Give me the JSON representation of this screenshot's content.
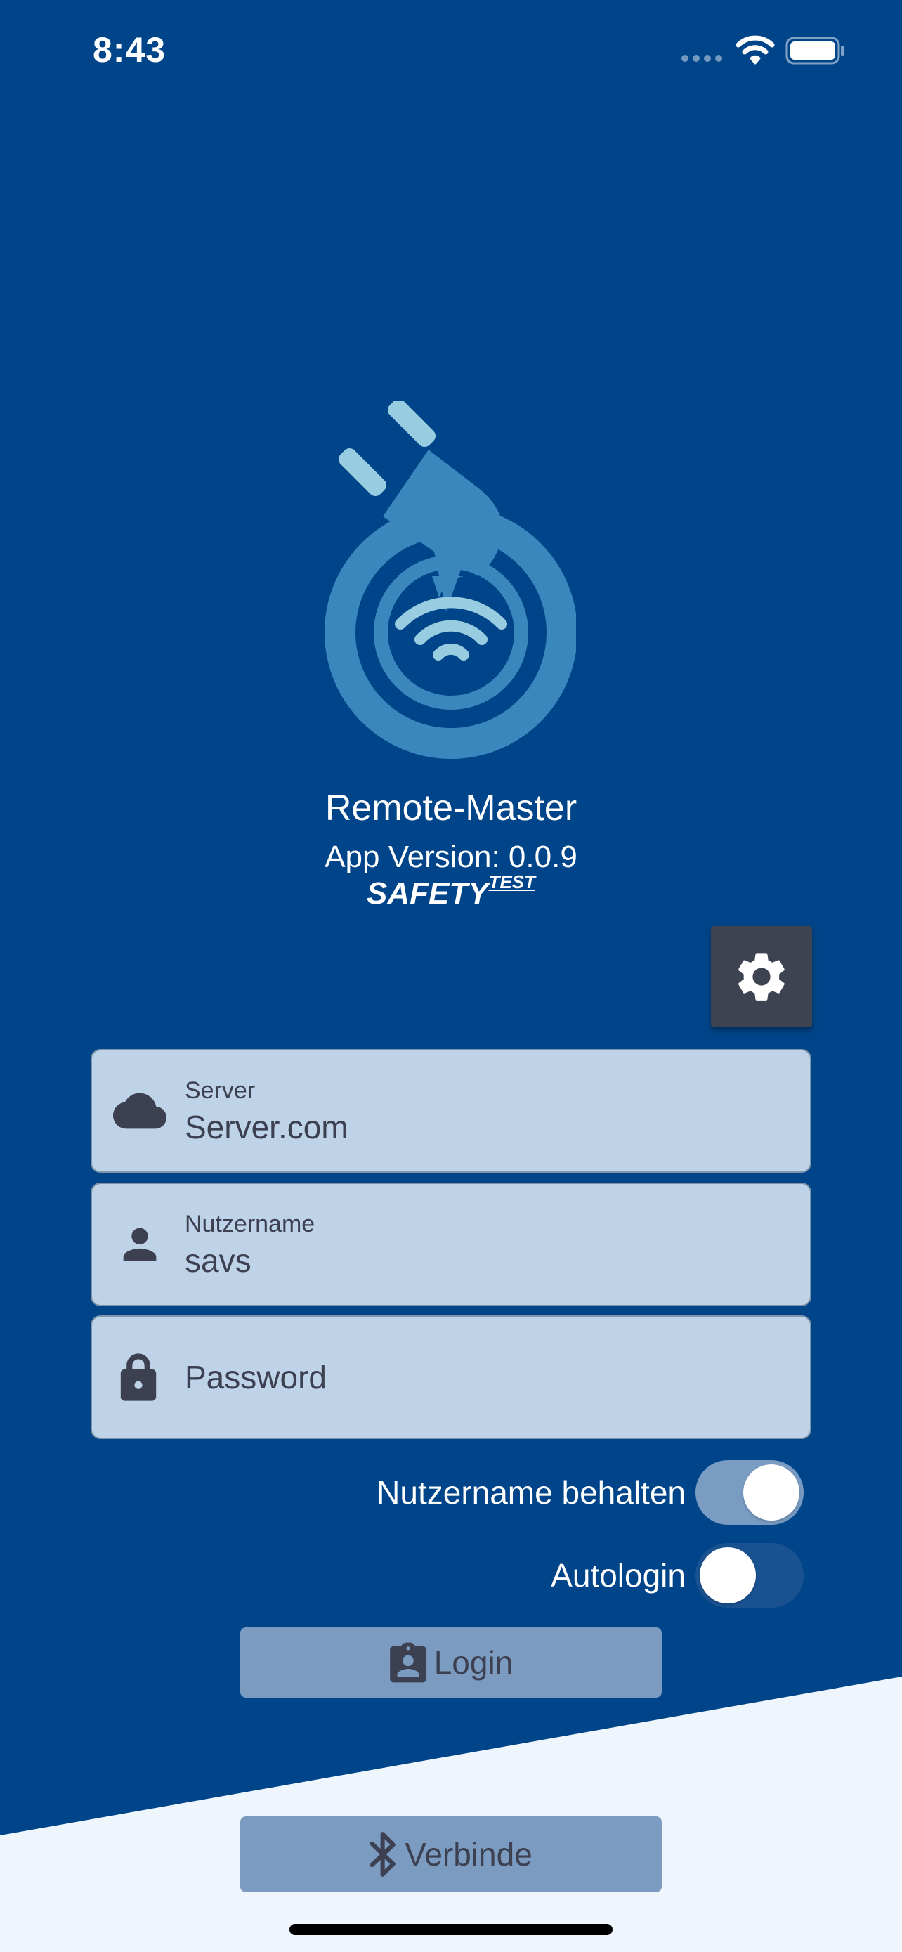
{
  "status_bar": {
    "time": "8:43"
  },
  "app": {
    "name": "Remote-Master",
    "version": "App Version: 0.0.9",
    "brand_main": "SAFETY",
    "brand_sup": "TEST"
  },
  "form": {
    "server": {
      "label": "Server",
      "value": "Server.com"
    },
    "username": {
      "label": "Nutzername",
      "value": "savs"
    },
    "password": {
      "placeholder": "Password"
    }
  },
  "toggles": {
    "keep_username": {
      "label": "Nutzername behalten",
      "on": true
    },
    "autologin": {
      "label": "Autologin",
      "on": false
    }
  },
  "buttons": {
    "login": "Login",
    "connect": "Verbinde"
  },
  "icons": [
    "cloud-icon",
    "person-icon",
    "lock-icon",
    "gear-icon",
    "badge-icon",
    "bluetooth-icon",
    "wifi-icon",
    "battery-icon"
  ],
  "colors": {
    "background": "#004589",
    "field_bg": "#bed3e8",
    "button_bg": "#7b9bc1",
    "settings_bg": "#3e4351",
    "logo_blue": "#3a87bd",
    "logo_light": "#98cce0"
  }
}
